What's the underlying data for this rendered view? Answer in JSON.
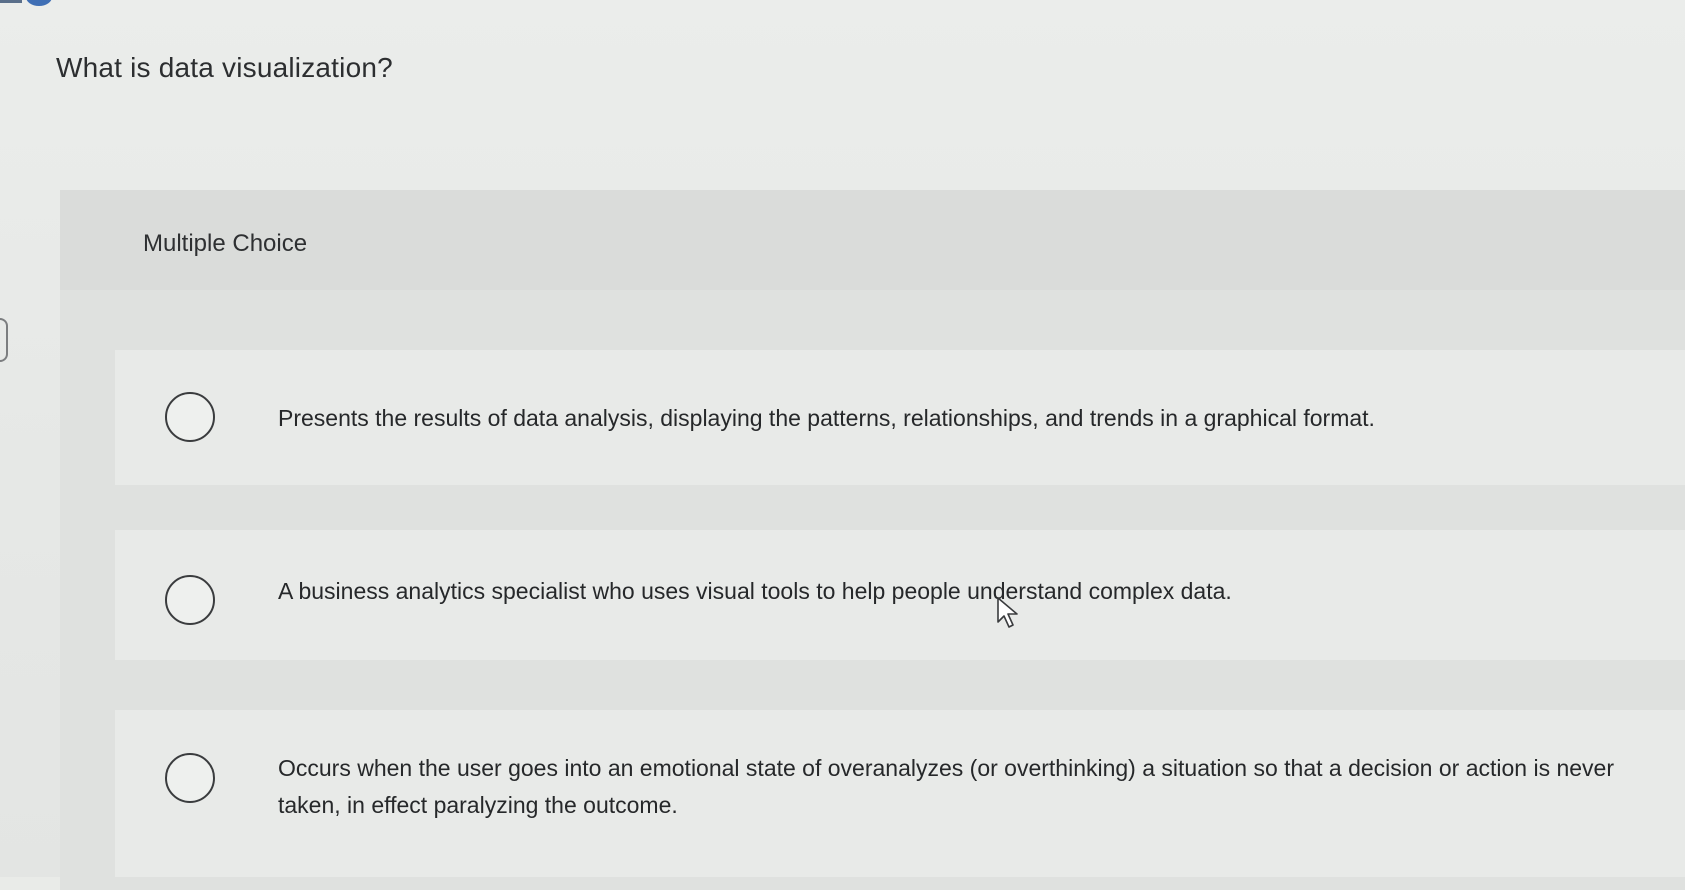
{
  "question": {
    "text": "What is data visualization?"
  },
  "multiple_choice": {
    "label": "Multiple Choice",
    "options": [
      {
        "text": "Presents the results of data analysis, displaying the patterns, relationships, and trends in a graphical format.",
        "selected": false
      },
      {
        "text": "A business analytics specialist who uses visual tools to help people understand complex data.",
        "selected": false
      },
      {
        "text": "Occurs when the user goes into an emotional state of overanalyzes (or overthinking) a situation so that a decision or action is never taken, in effect paralyzing the outcome.",
        "selected": false
      }
    ]
  },
  "icons": {
    "radio": "radio-button-unselected-icon",
    "cursor": "mouse-pointer-icon"
  },
  "colors": {
    "background": "#e9ebe8",
    "panel": "#dfe1df",
    "option_background": "#e8eae8",
    "text": "#2a2c2e"
  }
}
